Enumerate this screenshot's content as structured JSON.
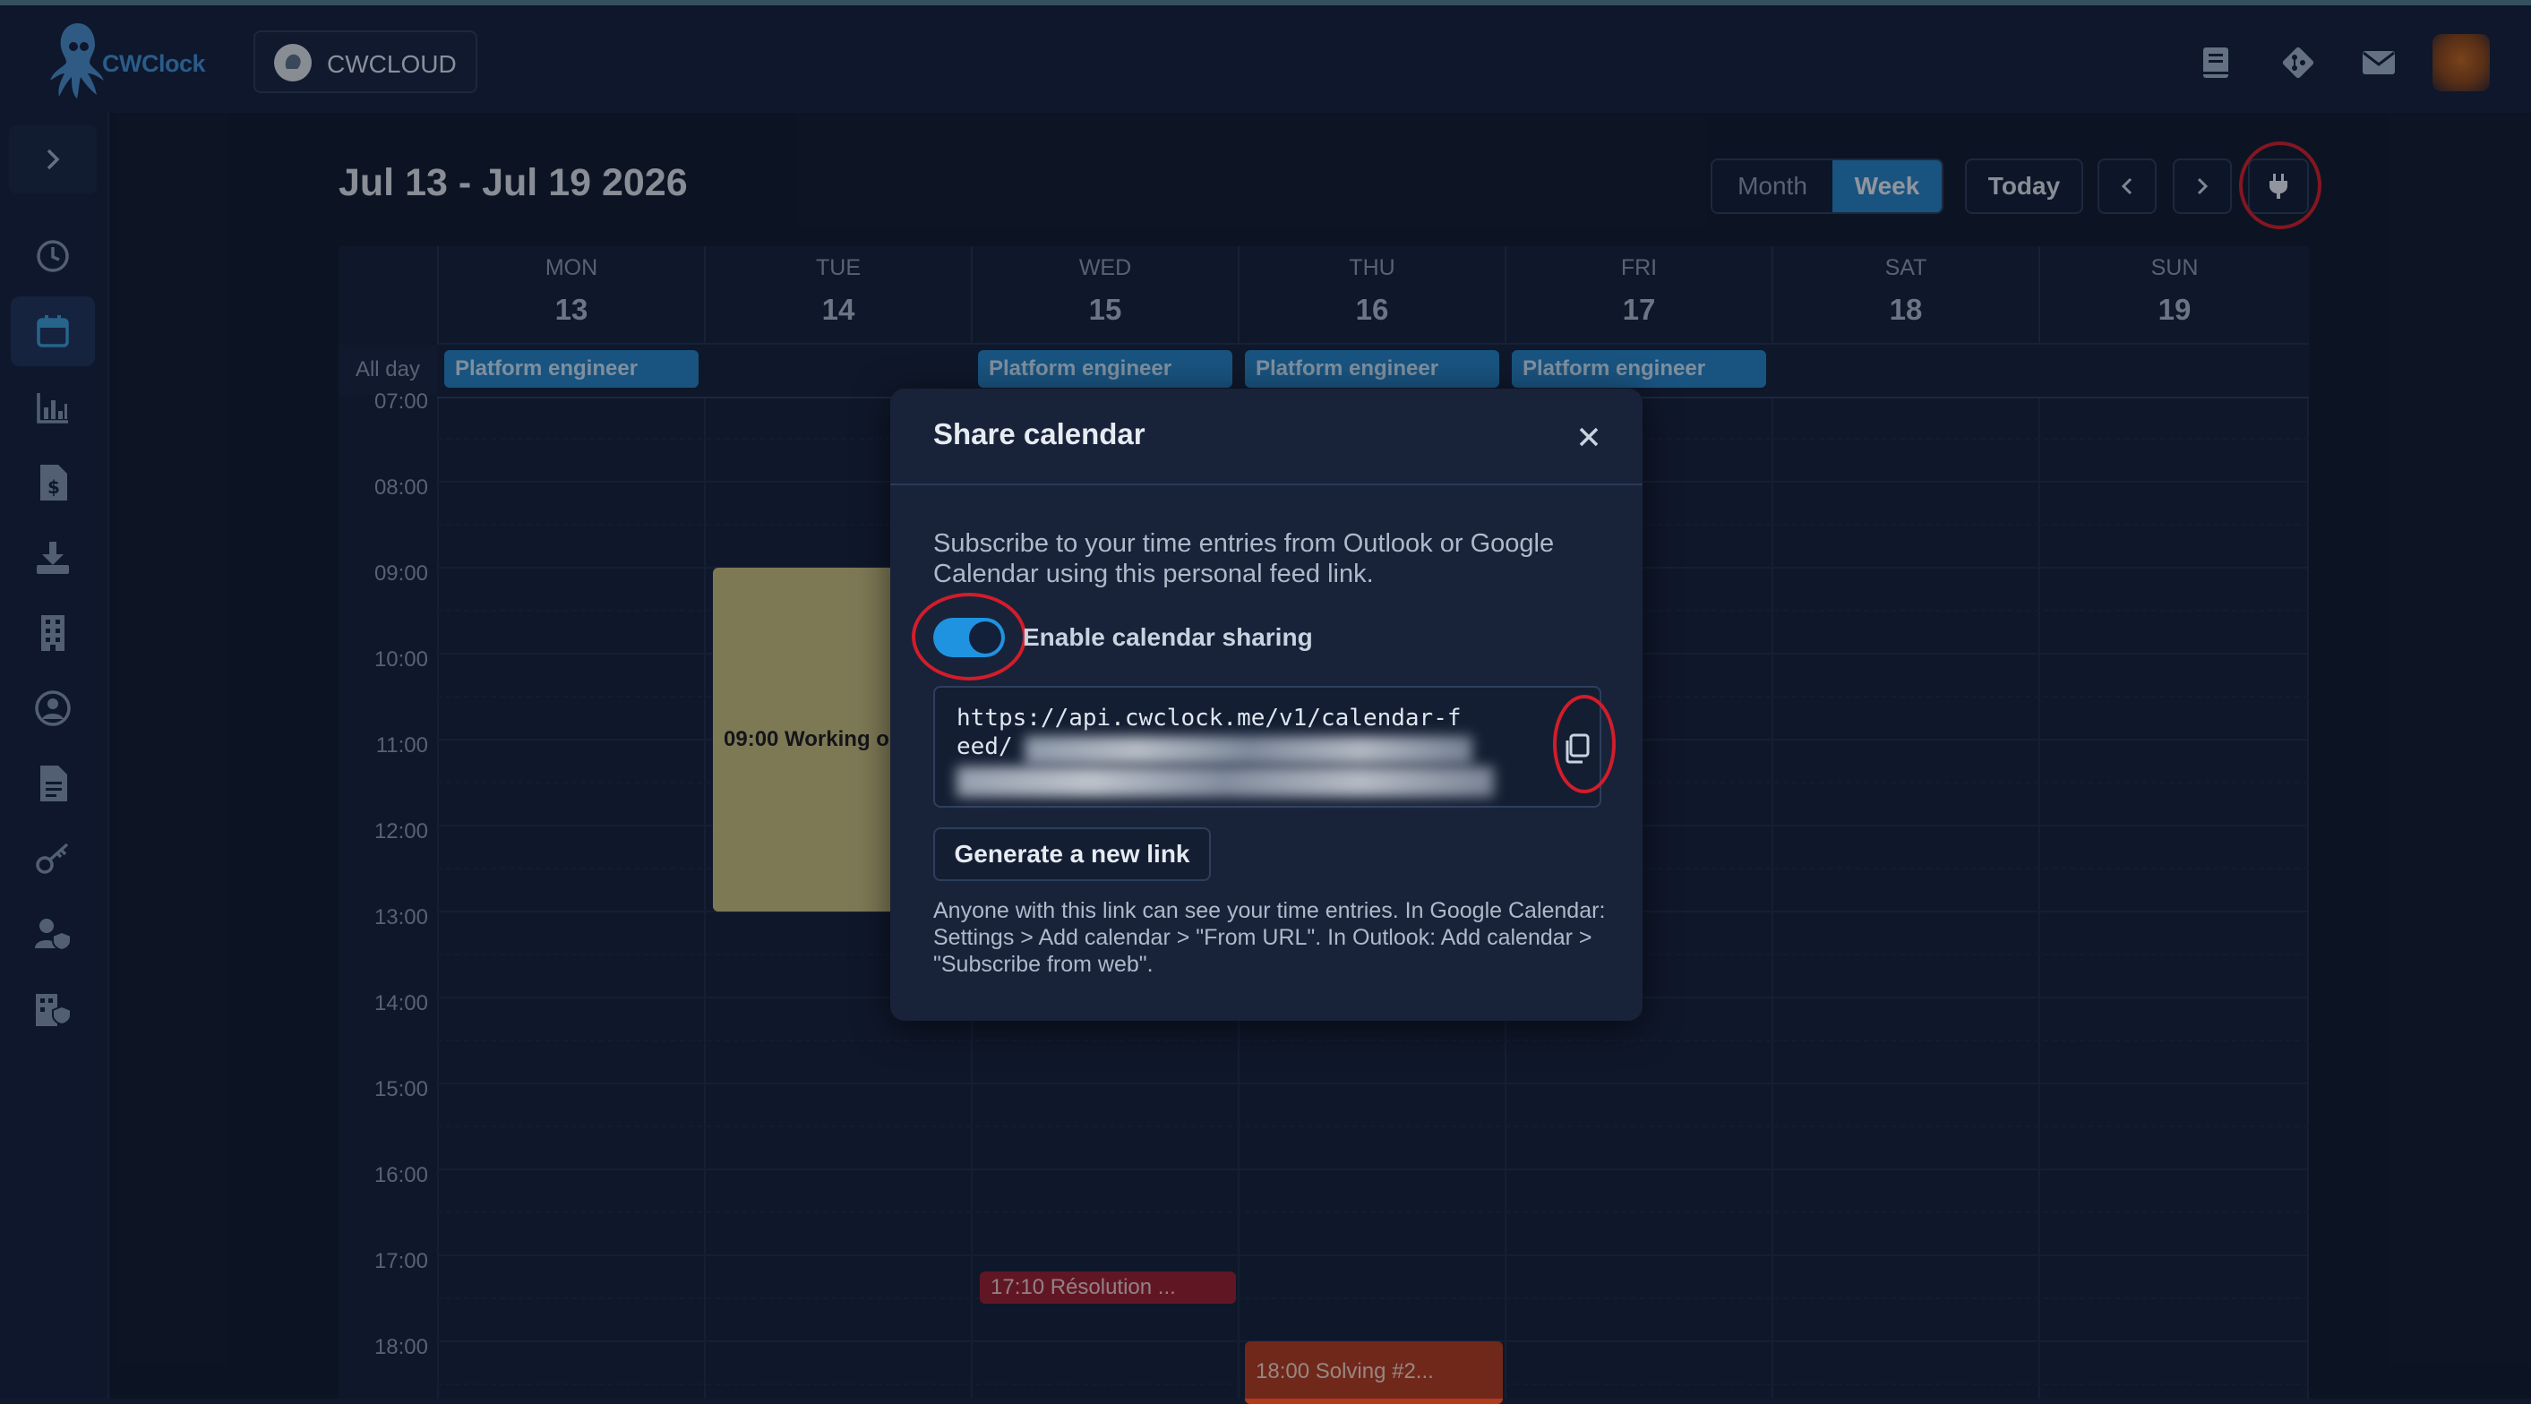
{
  "app": {
    "logo_text": "CWClock",
    "org_name": "CWCLOUD"
  },
  "topbar_icons": [
    "book-icon",
    "git-icon",
    "mail-icon",
    "user-avatar"
  ],
  "sidebar": {
    "items": [
      {
        "name": "sidebar-item-time",
        "icon": "clock-icon"
      },
      {
        "name": "sidebar-item-calendar",
        "icon": "calendar-icon",
        "active": true
      },
      {
        "name": "sidebar-item-reports",
        "icon": "bar-chart-icon"
      },
      {
        "name": "sidebar-item-invoices",
        "icon": "invoice-icon"
      },
      {
        "name": "sidebar-item-export",
        "icon": "download-icon"
      },
      {
        "name": "sidebar-item-companies",
        "icon": "building-icon"
      },
      {
        "name": "sidebar-item-profile",
        "icon": "user-circle-icon"
      },
      {
        "name": "sidebar-item-documents",
        "icon": "document-icon"
      },
      {
        "name": "sidebar-item-keys",
        "icon": "key-icon"
      },
      {
        "name": "sidebar-item-user-admin",
        "icon": "user-shield-icon"
      },
      {
        "name": "sidebar-item-company-admin",
        "icon": "building-shield-icon"
      }
    ]
  },
  "calendar": {
    "range_title": "Jul 13 - Jul 19 2026",
    "view_buttons": {
      "month": "Month",
      "week": "Week",
      "active": "Week"
    },
    "today_label": "Today",
    "prev_icon": "chevron-left-icon",
    "next_icon": "chevron-right-icon",
    "share_icon": "plug-icon",
    "all_day_label": "All day",
    "days": [
      {
        "dow": "MON",
        "num": "13"
      },
      {
        "dow": "TUE",
        "num": "14"
      },
      {
        "dow": "WED",
        "num": "15"
      },
      {
        "dow": "THU",
        "num": "16"
      },
      {
        "dow": "FRI",
        "num": "17"
      },
      {
        "dow": "SAT",
        "num": "18"
      },
      {
        "dow": "SUN",
        "num": "19"
      }
    ],
    "all_day_events": [
      {
        "day": "MON",
        "label": "Platform engineer"
      },
      {
        "day": "WED",
        "label": "Platform engineer"
      },
      {
        "day": "THU",
        "label": "Platform engineer"
      },
      {
        "day": "FRI",
        "label": "Platform engineer"
      }
    ],
    "hours": [
      "07:00",
      "08:00",
      "09:00",
      "10:00",
      "11:00",
      "12:00",
      "13:00",
      "14:00",
      "15:00",
      "16:00",
      "17:00",
      "18:00"
    ],
    "events": {
      "working": {
        "label": "09:00 Working o",
        "color": "#c9bd7d"
      },
      "resolution": {
        "label": "17:10 Résolution ...",
        "color": "#9a1f2c"
      },
      "solving": {
        "label": "18:00 Solving #2...",
        "color": "#b23b1e"
      }
    },
    "event_color": "#2680c0"
  },
  "share_modal": {
    "title": "Share calendar",
    "close_icon": "close-icon",
    "description": "Subscribe to your time entries from Outlook or Google Calendar using this personal feed link.",
    "toggle_label": "Enable calendar sharing",
    "toggle_on": true,
    "feed_url_visible": "https://api.cwclock.me/v1/calendar-feed/",
    "copy_icon": "copy-icon",
    "generate_label": "Generate a new link",
    "note": "Anyone with this link can see your time entries. In Google Calendar: Settings > Add calendar > \"From URL\". In Outlook: Add calendar > \"Subscribe from web\"."
  },
  "colors": {
    "accent": "#1f93e0",
    "highlight_ring": "#d21d2a",
    "background": "#111a2c"
  }
}
